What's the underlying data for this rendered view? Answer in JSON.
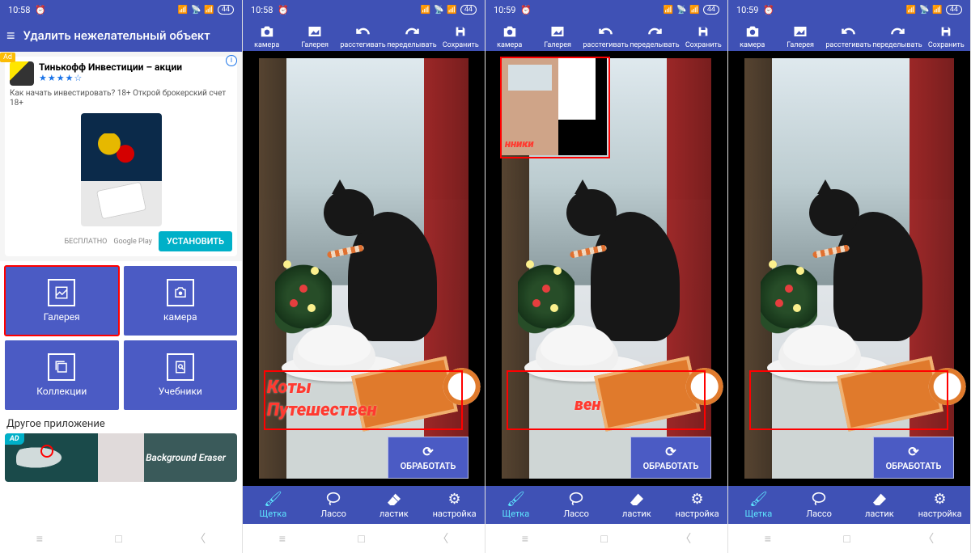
{
  "status": {
    "time_a": "10:58",
    "time_b": "10:59",
    "battery": "44"
  },
  "screen1": {
    "title": "Удалить нежелательный объект",
    "ad": {
      "badge": "Ad",
      "title": "Тинькофф Инвестиции – акции",
      "desc": "Как начать инвестировать? 18+ Открой брокерский счет 18+",
      "free": "БЕСПЛАТНО",
      "store": "Google Play",
      "install": "УСТАНОВИТЬ"
    },
    "tiles": {
      "gallery": "Галерея",
      "camera": "камера",
      "collections": "Коллекции",
      "tutorials": "Учебники"
    },
    "other_label": "Другое приложение",
    "other_app": {
      "name": "Background Eraser",
      "badge": "AD"
    }
  },
  "editor": {
    "toolbar": {
      "camera": "камера",
      "gallery": "Галерея",
      "undo": "расстегивать",
      "redo": "переделывать",
      "save": "Сохранить"
    },
    "bottom": {
      "brush": "Щетка",
      "lasso": "Лассо",
      "eraser": "ластик",
      "settings": "настройка"
    },
    "process": "ОБРАБОТАТЬ",
    "watermark": {
      "line1": "Коты",
      "line2": "Путешествен",
      "thumb": "нники",
      "partial": "вен"
    }
  }
}
